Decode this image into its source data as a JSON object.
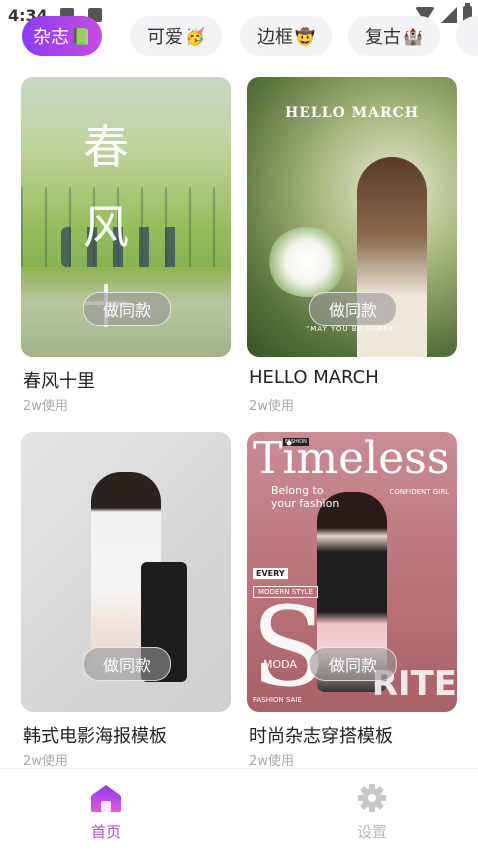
{
  "status_bar": {
    "time": "4:34"
  },
  "categories": [
    {
      "label": "杂志",
      "emoji": "📗",
      "active": true
    },
    {
      "label": "可爱",
      "emoji": "🥳",
      "active": false
    },
    {
      "label": "边框",
      "emoji": "🤠",
      "active": false
    },
    {
      "label": "复古",
      "emoji": "🏰",
      "active": false
    }
  ],
  "templates": [
    {
      "title": "春风十里",
      "usage": "2w使用",
      "button": "做同款",
      "poster_text": "春风十里"
    },
    {
      "title": "HELLO MARCH",
      "usage": "2w使用",
      "button": "做同款",
      "poster_text": "HELLO MARCH",
      "poster_tag": "\"MAY YOU BE HAPPY\""
    },
    {
      "title": "韩式电影海报模板",
      "usage": "2w使用",
      "button": "做同款"
    },
    {
      "title": "时尚杂志穿搭模板",
      "usage": "2w使用",
      "button": "做同款",
      "poster_text": "Timeless",
      "poster_sub": "Belong to your fashion",
      "poster_conf": "CONFIDENT GIRL",
      "poster_every": "EVERY",
      "poster_modern": "MODERN STYLE",
      "poster_moda": "MODA",
      "poster_fashion": "FASHION SAIE",
      "poster_rite": "RITE",
      "poster_s": "S",
      "poster_logo": "FASHION"
    }
  ],
  "bottom_nav": {
    "home_label": "首页",
    "settings_label": "设置"
  },
  "colors": {
    "accent": "#b44ad8",
    "chip_gradient_start": "#8a3cf5",
    "chip_gradient_end": "#c84ce0"
  }
}
